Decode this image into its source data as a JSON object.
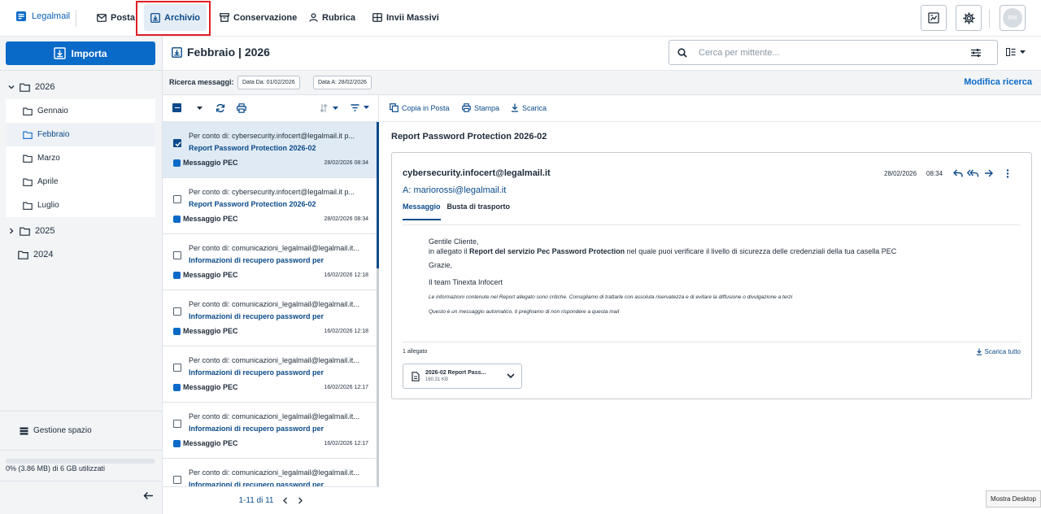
{
  "brand": {
    "name": "Legalmail"
  },
  "nav": [
    {
      "label": "Posta"
    },
    {
      "label": "Archivio"
    },
    {
      "label": "Conservazione"
    },
    {
      "label": "Rubrica"
    },
    {
      "label": "Invii Massivi"
    }
  ],
  "user": {
    "initials": "RM"
  },
  "sidebar": {
    "import_label": "Importa",
    "years": [
      {
        "label": "2026",
        "expanded": true
      },
      {
        "label": "2025",
        "expanded": false
      },
      {
        "label": "2024",
        "expanded": false
      }
    ],
    "months": [
      "Gennaio",
      "Febbraio",
      "Marzo",
      "Aprile",
      "Luglio"
    ],
    "selected_month": "Febbraio",
    "space_label": "Gestione spazio",
    "quota_text": "0% (3.86 MB) di 6 GB utilizzati",
    "quota_fraction": 0
  },
  "header": {
    "title": "Febbraio | 2026",
    "search_placeholder": "Cerca per mittente..."
  },
  "filters": {
    "label": "Ricerca messaggi:",
    "date_from": "Data Da: 01/02/2026",
    "date_to": "Data A: 28/02/2026",
    "modify_label": "Modifica ricerca"
  },
  "messages": [
    {
      "from": "Per conto di: cybersecurity.infocert@legalmail.it p...",
      "subject": "Report Password Protection 2026-02",
      "type": "Messaggio PEC",
      "date": "28/02/2026 08:34",
      "checked": true
    },
    {
      "from": "Per conto di: cybersecurity.infocert@legalmail.it p...",
      "subject": "Report Password Protection 2026-02",
      "type": "Messaggio PEC",
      "date": "28/02/2026 08:34",
      "checked": false
    },
    {
      "from": "Per conto di: comunicazioni_legalmail@legalmail.it...",
      "subject": "Informazioni di recupero password per",
      "type": "Messaggio PEC",
      "date": "16/02/2026 12:18",
      "checked": false
    },
    {
      "from": "Per conto di: comunicazioni_legalmail@legalmail.it...",
      "subject": "Informazioni di recupero password per",
      "type": "Messaggio PEC",
      "date": "16/02/2026 12:18",
      "checked": false
    },
    {
      "from": "Per conto di: comunicazioni_legalmail@legalmail.it...",
      "subject": "Informazioni di recupero password per",
      "type": "Messaggio PEC",
      "date": "16/02/2026 12:17",
      "checked": false
    },
    {
      "from": "Per conto di: comunicazioni_legalmail@legalmail.it...",
      "subject": "Informazioni di recupero password per",
      "type": "Messaggio PEC",
      "date": "16/02/2026 12:17",
      "checked": false
    },
    {
      "from": "Per conto di: comunicazioni_legalmail@legalmail.it...",
      "subject": "Informazioni di recupero password per",
      "type": "",
      "date": "",
      "checked": false
    }
  ],
  "pager": {
    "text": "1-11 di 11"
  },
  "reader_toolbar": {
    "copy": "Copia in Posta",
    "print": "Stampa",
    "download": "Scarica"
  },
  "reader": {
    "subject": "Report Password Protection 2026-02",
    "sender": "cybersecurity.infocert@legalmail.it",
    "date": "28/02/2026",
    "time": "08:34",
    "to": "A: mariorossi@legalmail.it",
    "tabs": [
      "Messaggio",
      "Busta di trasporto"
    ],
    "body": {
      "greeting": "Gentile Cliente,",
      "line1_pre": "in allegato il",
      "line1_bold": "Report del servizio Pec Password Protection",
      "line1_post": "nel quale puoi verificare il livello di sicurezza delle credenziali della tua casella PEC",
      "thanks": "Grazie,",
      "sign": "Il team Tinexta Infocert",
      "note1": "Le informazioni contenute nel Report allegato sono critiche. Consigliamo di trattarle con assoluta riservatezza e di evitare la diffusione o divulgazione a terzi",
      "note2": "Questo è un messaggio automatico, ti preghiamo di non rispondere a questa mail"
    },
    "attachments_count": "1 allegato",
    "download_all": "Scarica tutto",
    "attachment": {
      "name": "2026-02 Report Pass...",
      "size": "160.31 KB"
    }
  },
  "tooltip": "Mostra Desktop",
  "colors": {
    "primary": "#0a6ac8",
    "navy": "#0a4a8a",
    "highlight": "#e01e25"
  }
}
